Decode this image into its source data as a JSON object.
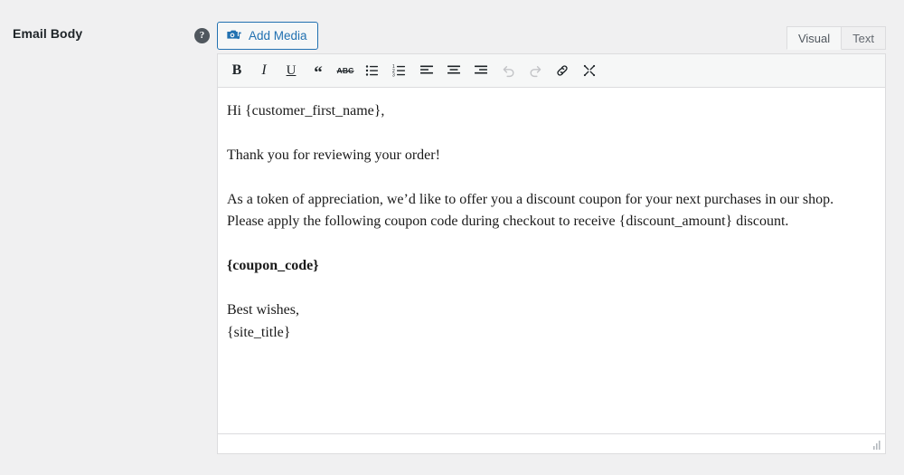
{
  "field": {
    "label": "Email Body",
    "help_icon": "help-circle-icon",
    "help_tooltip": "?"
  },
  "toolbar_top": {
    "add_media_label": "Add Media",
    "add_media_icon": "media-camera-music-icon",
    "accent_color": "#2271b1"
  },
  "tabs": [
    {
      "label": "Visual",
      "active": true
    },
    {
      "label": "Text",
      "active": false
    }
  ],
  "editor_toolbar": {
    "buttons": [
      {
        "name": "bold",
        "icon": "bold-icon",
        "glyph": "B",
        "disabled": false
      },
      {
        "name": "italic",
        "icon": "italic-icon",
        "glyph": "I",
        "disabled": false
      },
      {
        "name": "underline",
        "icon": "underline-icon",
        "glyph": "U",
        "disabled": false
      },
      {
        "name": "blockquote",
        "icon": "blockquote-icon",
        "glyph": "“",
        "disabled": false
      },
      {
        "name": "strikethrough",
        "icon": "strikethrough-icon",
        "glyph": "ABC",
        "disabled": false
      },
      {
        "name": "bullet-list",
        "icon": "unordered-list-icon",
        "glyph": "",
        "disabled": false
      },
      {
        "name": "numbered-list",
        "icon": "ordered-list-icon",
        "glyph": "",
        "disabled": false
      },
      {
        "name": "align-left",
        "icon": "align-left-icon",
        "glyph": "",
        "disabled": false
      },
      {
        "name": "align-center",
        "icon": "align-center-icon",
        "glyph": "",
        "disabled": false
      },
      {
        "name": "align-right",
        "icon": "align-right-icon",
        "glyph": "",
        "disabled": false
      },
      {
        "name": "undo",
        "icon": "undo-icon",
        "glyph": "",
        "disabled": true
      },
      {
        "name": "redo",
        "icon": "redo-icon",
        "glyph": "",
        "disabled": true
      },
      {
        "name": "insert-link",
        "icon": "link-icon",
        "glyph": "",
        "disabled": false
      },
      {
        "name": "fullscreen",
        "icon": "fullscreen-icon",
        "glyph": "",
        "disabled": false
      }
    ]
  },
  "body": {
    "line_1": "Hi {customer_first_name},",
    "line_2": "Thank you for reviewing your order!",
    "line_3a": "As a token of appreciation, we’d like to offer you a discount coupon for your next purchases in our shop.",
    "line_3b": "Please apply the following coupon code during checkout to receive {discount_amount} discount.",
    "line_4": "{coupon_code}",
    "line_5a": "Best wishes,",
    "line_5b": "{site_title}"
  },
  "statusbar": {
    "path": "",
    "resize_handle_icon": "resize-grip-icon"
  }
}
